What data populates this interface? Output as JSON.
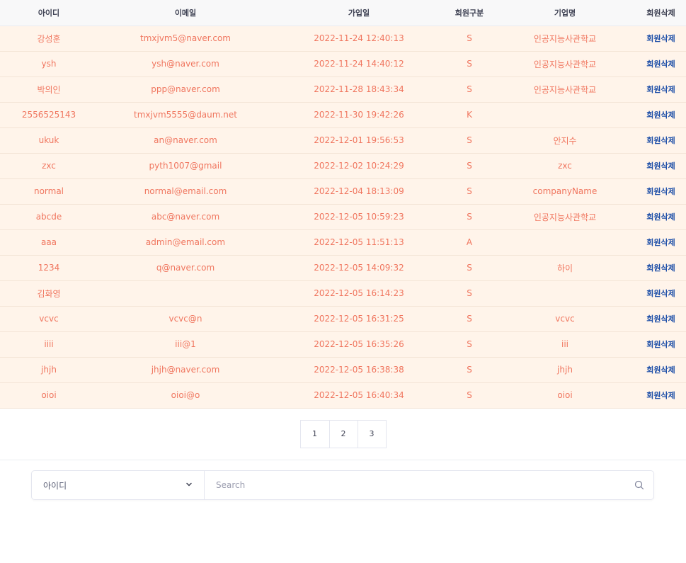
{
  "table": {
    "headers": [
      "아이디",
      "이메일",
      "가입일",
      "회원구분",
      "기업명",
      "회원삭제"
    ],
    "rows": [
      {
        "id": "강성훈",
        "email": "tmxjvm5@naver.com",
        "joined": "2022-11-24 12:40:13",
        "type": "S",
        "company": "인공지능사관학교",
        "action": "회원삭제"
      },
      {
        "id": "ysh",
        "email": "ysh@naver.com",
        "joined": "2022-11-24 14:40:12",
        "type": "S",
        "company": "인공지능사관학교",
        "action": "회원삭제"
      },
      {
        "id": "박의인",
        "email": "ppp@naver.com",
        "joined": "2022-11-28 18:43:34",
        "type": "S",
        "company": "인공지능사관학교",
        "action": "회원삭제"
      },
      {
        "id": "2556525143",
        "email": "tmxjvm5555@daum.net",
        "joined": "2022-11-30 19:42:26",
        "type": "K",
        "company": "",
        "action": "회원삭제"
      },
      {
        "id": "ukuk",
        "email": "an@naver.com",
        "joined": "2022-12-01 19:56:53",
        "type": "S",
        "company": "안지수",
        "action": "회원삭제"
      },
      {
        "id": "zxc",
        "email": "pyth1007@gmail",
        "joined": "2022-12-02 10:24:29",
        "type": "S",
        "company": "zxc",
        "action": "회원삭제"
      },
      {
        "id": "normal",
        "email": "normal@email.com",
        "joined": "2022-12-04 18:13:09",
        "type": "S",
        "company": "companyName",
        "action": "회원삭제"
      },
      {
        "id": "abcde",
        "email": "abc@naver.com",
        "joined": "2022-12-05 10:59:23",
        "type": "S",
        "company": "인공지능사관학교",
        "action": "회원삭제"
      },
      {
        "id": "aaa",
        "email": "admin@email.com",
        "joined": "2022-12-05 11:51:13",
        "type": "A",
        "company": "",
        "action": "회원삭제"
      },
      {
        "id": "1234",
        "email": "q@naver.com",
        "joined": "2022-12-05 14:09:32",
        "type": "S",
        "company": "하이",
        "action": "회원삭제"
      },
      {
        "id": "김화영",
        "email": "",
        "joined": "2022-12-05 16:14:23",
        "type": "S",
        "company": "",
        "action": "회원삭제"
      },
      {
        "id": "vcvc",
        "email": "vcvc@n",
        "joined": "2022-12-05 16:31:25",
        "type": "S",
        "company": "vcvc",
        "action": "회원삭제"
      },
      {
        "id": "iiii",
        "email": "iii@1",
        "joined": "2022-12-05 16:35:26",
        "type": "S",
        "company": "iii",
        "action": "회원삭제"
      },
      {
        "id": "jhjh",
        "email": "jhjh@naver.com",
        "joined": "2022-12-05 16:38:38",
        "type": "S",
        "company": "jhjh",
        "action": "회원삭제"
      },
      {
        "id": "oioi",
        "email": "oioi@o",
        "joined": "2022-12-05 16:40:34",
        "type": "S",
        "company": "oioi",
        "action": "회원삭제"
      }
    ]
  },
  "pagination": {
    "pages": [
      "1",
      "2",
      "3"
    ]
  },
  "search": {
    "field_selected": "아이디",
    "placeholder": "Search",
    "chevron_icon": "chevron-down-icon",
    "search_icon": "search-icon"
  },
  "colors": {
    "row_background": "#fff4ea",
    "row_text": "#f0765f",
    "delete_link": "#1e4fa8",
    "header_background": "#f8f8f9"
  }
}
